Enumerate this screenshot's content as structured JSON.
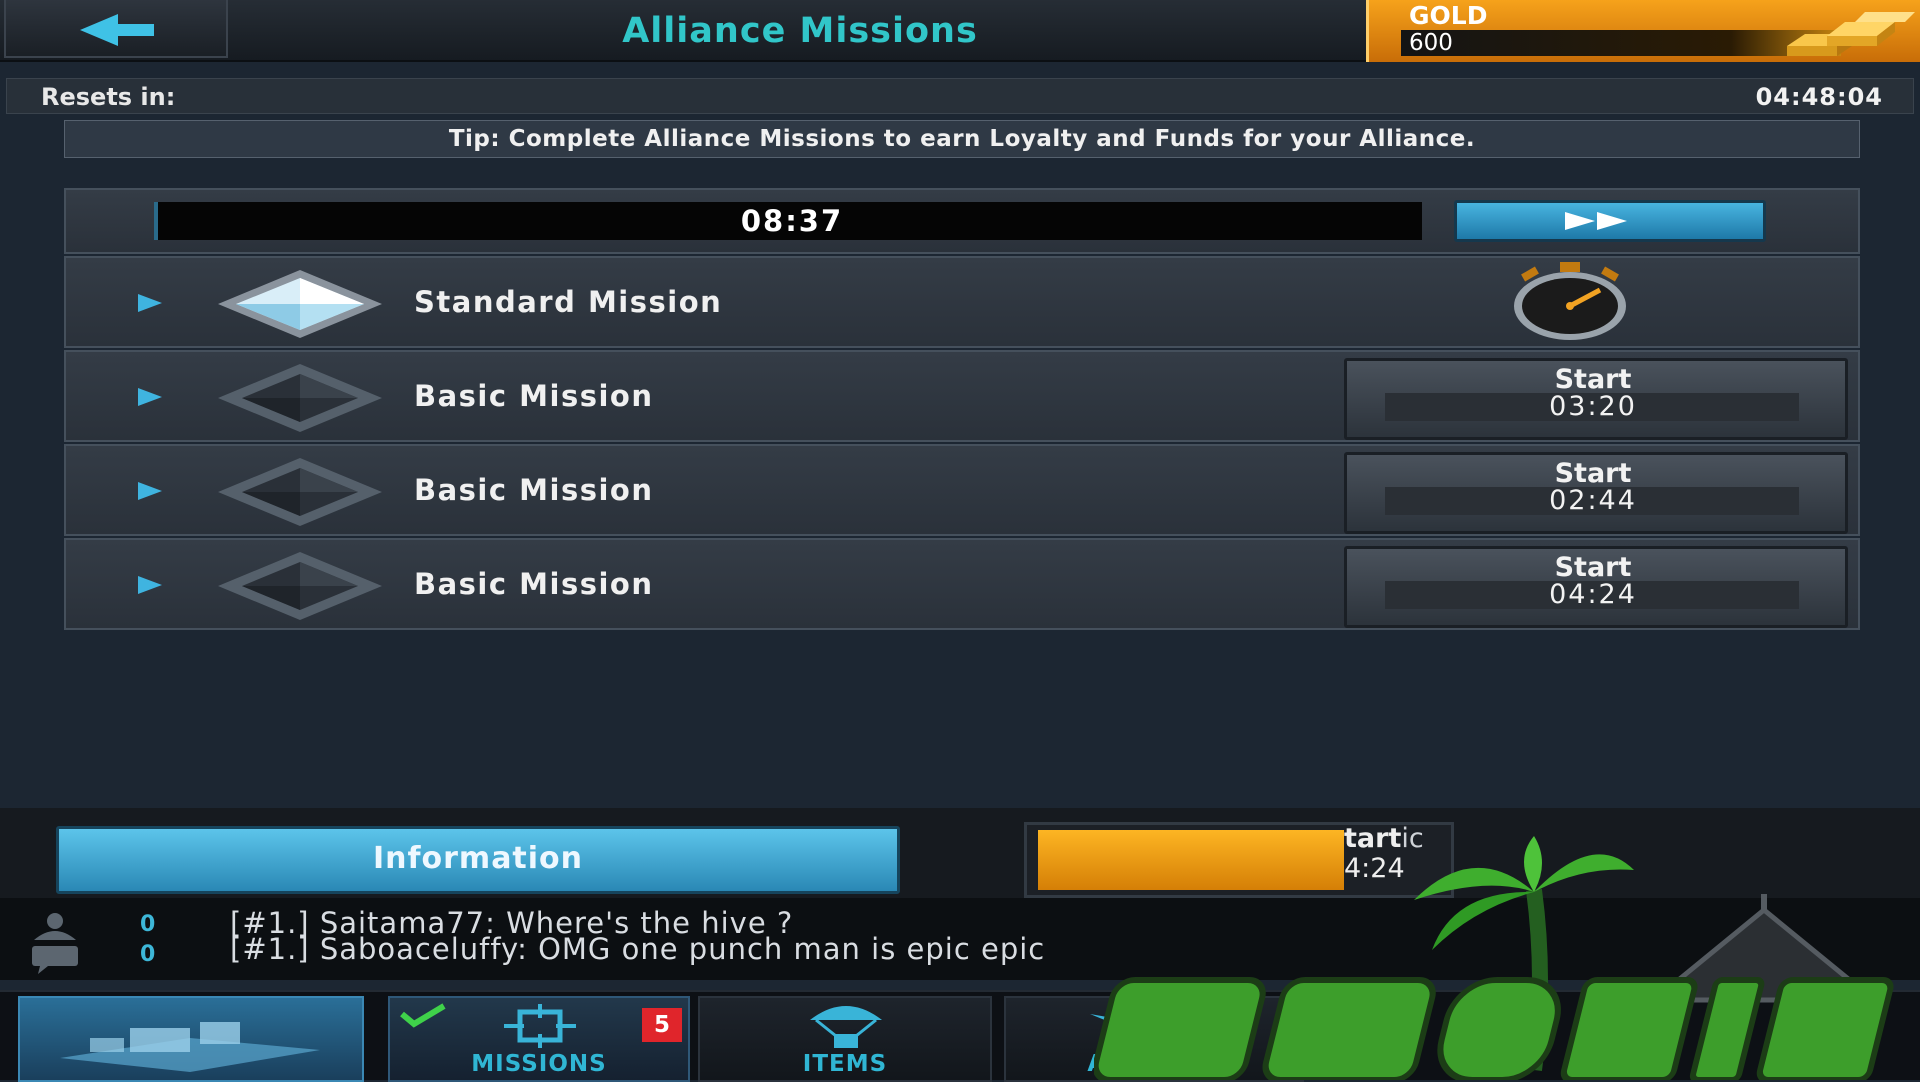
{
  "header": {
    "back_icon": "back-arrow-icon",
    "title": "Alliance Missions",
    "gold_label": "GOLD",
    "gold_value": "600",
    "gold_icon": "gold-bars-icon"
  },
  "resets": {
    "label": "Resets in:",
    "time": "04:48:04"
  },
  "tip": "Tip: Complete Alliance Missions to earn Loyalty and Funds for your Alliance.",
  "active_timer": {
    "time": "08:37",
    "speed_up_icon": "fast-forward-icon"
  },
  "missions": [
    {
      "name": "Standard Mission",
      "status_icon": "stopwatch-icon"
    },
    {
      "name": "Basic Mission",
      "start_label": "Start",
      "start_time": "03:20"
    },
    {
      "name": "Basic Mission",
      "start_label": "Start",
      "start_time": "02:44"
    },
    {
      "name": "Basic Mission",
      "start_label": "Start",
      "start_time": "04:24"
    }
  ],
  "info_button": "Information",
  "promo_overlay": {
    "line1": "tart",
    "line1_tail": "ic",
    "line2": "4:24"
  },
  "chat": {
    "user_count": "0",
    "message_count": "0",
    "messages": [
      "[#1.] Saitama77:  Where's the hive ?",
      "[#1.] Saboaceluffy: OMG one punch man is epic   epic"
    ]
  },
  "nav": {
    "missions_label": "MISSIONS",
    "missions_badge": "5",
    "items_label": "ITEMS",
    "alliance_label": "ALLIANCE"
  },
  "colors": {
    "title": "#31c6c9",
    "gold_panel": "#f6a21b",
    "accent_blue": "#48b4e0",
    "badge_red": "#e0252b",
    "nav_label": "#30b6d4"
  }
}
